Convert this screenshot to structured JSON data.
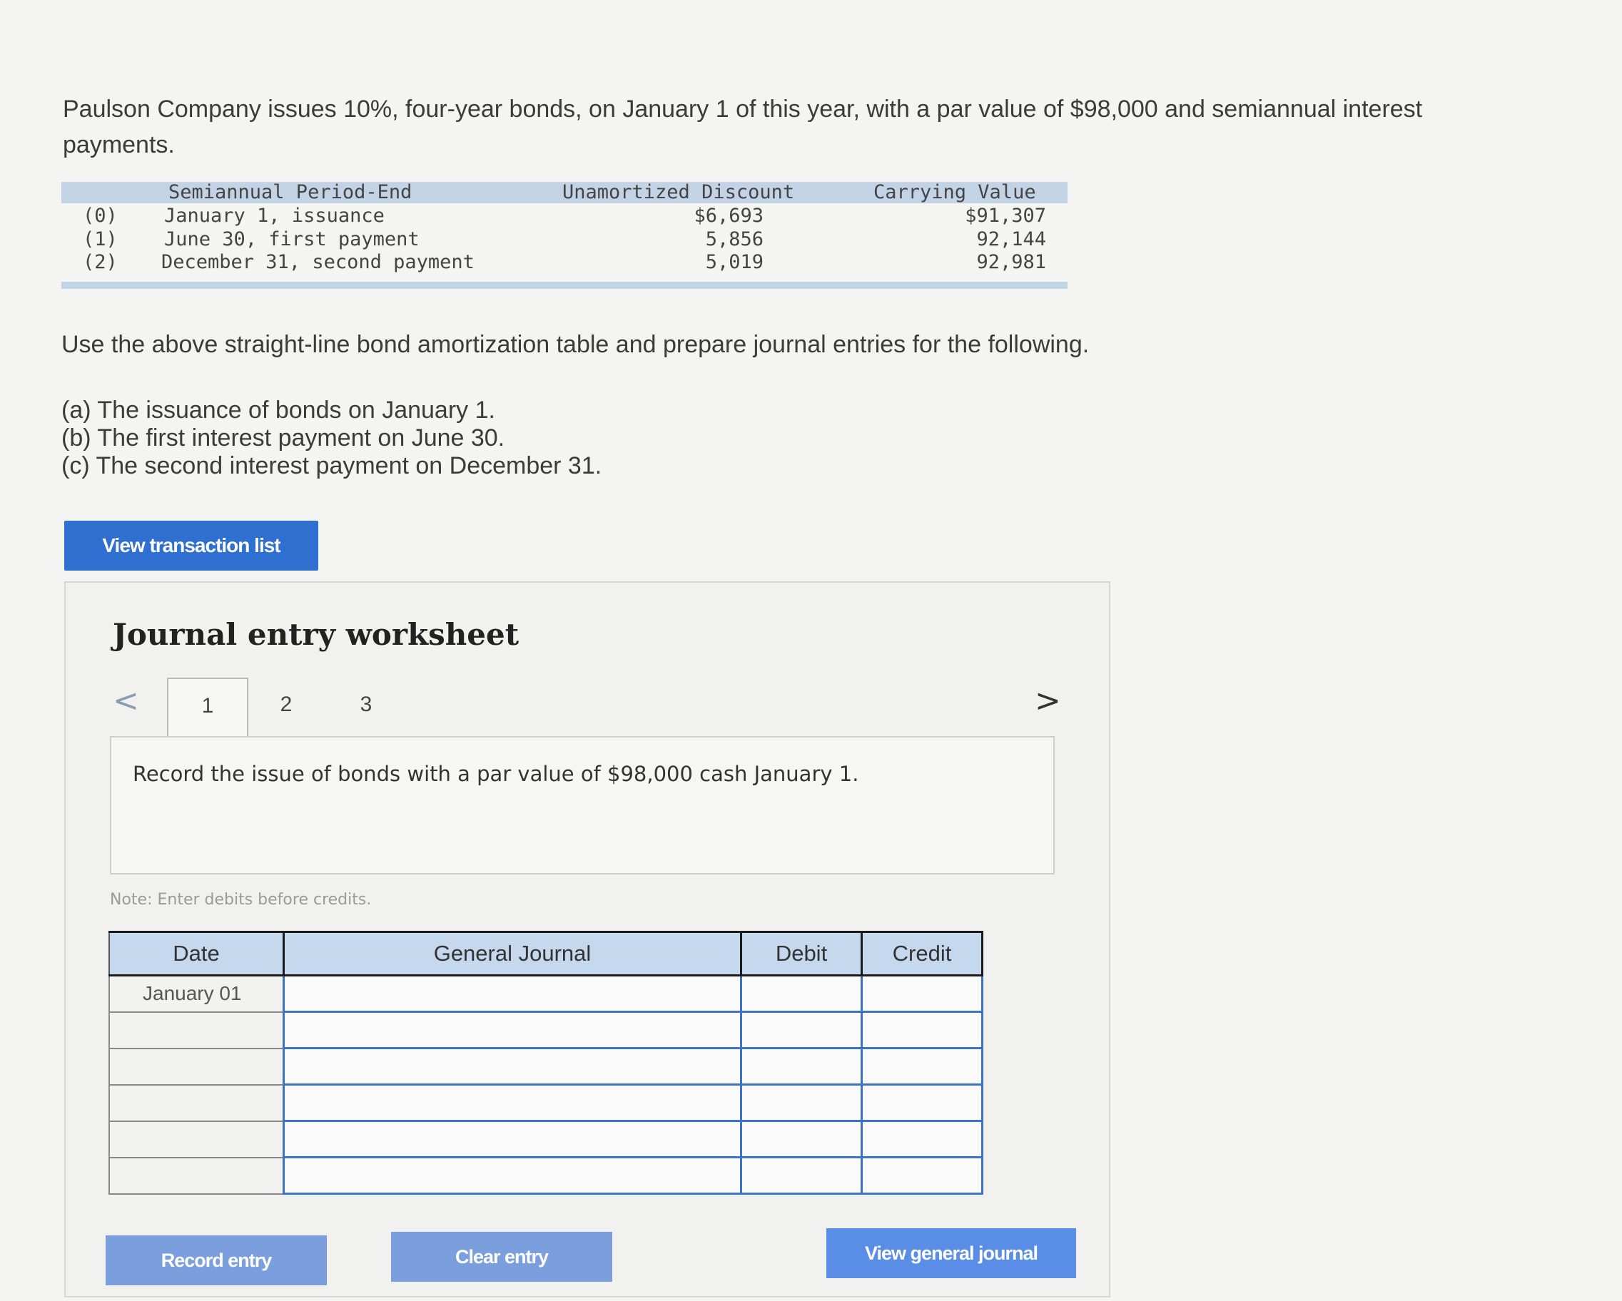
{
  "problem": {
    "line1": "Paulson Company issues 10%, four-year bonds, on January 1 of this year, with a par value of $98,000 and semiannual interest",
    "line2": "payments."
  },
  "amortization_table": {
    "headers": {
      "period": "Semiannual Period-End",
      "discount": "Unamortized Discount",
      "carrying": "Carrying Value"
    },
    "rows": [
      {
        "index": "(0)",
        "period": "January 1, issuance",
        "discount": "$6,693",
        "carrying": "$91,307"
      },
      {
        "index": "(1)",
        "period": "June 30, first payment",
        "discount": "5,856",
        "carrying": "92,144"
      },
      {
        "index": "(2)",
        "period": "December 31, second payment",
        "discount": "5,019",
        "carrying": "92,981"
      }
    ]
  },
  "instructions": {
    "lead": "Use the above straight-line bond amortization table and prepare journal entries for the following.",
    "items": [
      "(a) The issuance of bonds on January 1.",
      "(b) The first interest payment on June 30.",
      "(c) The second interest payment on December 31."
    ]
  },
  "view_transaction_list_label": "View transaction list",
  "worksheet": {
    "title": "Journal entry worksheet",
    "prev_glyph": "<",
    "next_glyph": ">",
    "tabs": [
      "1",
      "2",
      "3"
    ],
    "active_tab": "1",
    "prompt": "Record the issue of bonds with a par value of $98,000 cash January 1.",
    "note": "Note: Enter debits before credits.",
    "table_headers": {
      "date": "Date",
      "journal": "General Journal",
      "debit": "Debit",
      "credit": "Credit"
    },
    "rows": [
      {
        "date": "January 01",
        "journal": "",
        "debit": "",
        "credit": ""
      },
      {
        "date": "",
        "journal": "",
        "debit": "",
        "credit": ""
      },
      {
        "date": "",
        "journal": "",
        "debit": "",
        "credit": ""
      },
      {
        "date": "",
        "journal": "",
        "debit": "",
        "credit": ""
      },
      {
        "date": "",
        "journal": "",
        "debit": "",
        "credit": ""
      },
      {
        "date": "",
        "journal": "",
        "debit": "",
        "credit": ""
      }
    ],
    "buttons": {
      "record": "Record entry",
      "clear": "Clear entry",
      "view_journal": "View general journal"
    }
  },
  "colors": {
    "primary_button": "#2f6fd0",
    "table_header": "#c5d8ee",
    "input_border": "#3c73c7"
  }
}
